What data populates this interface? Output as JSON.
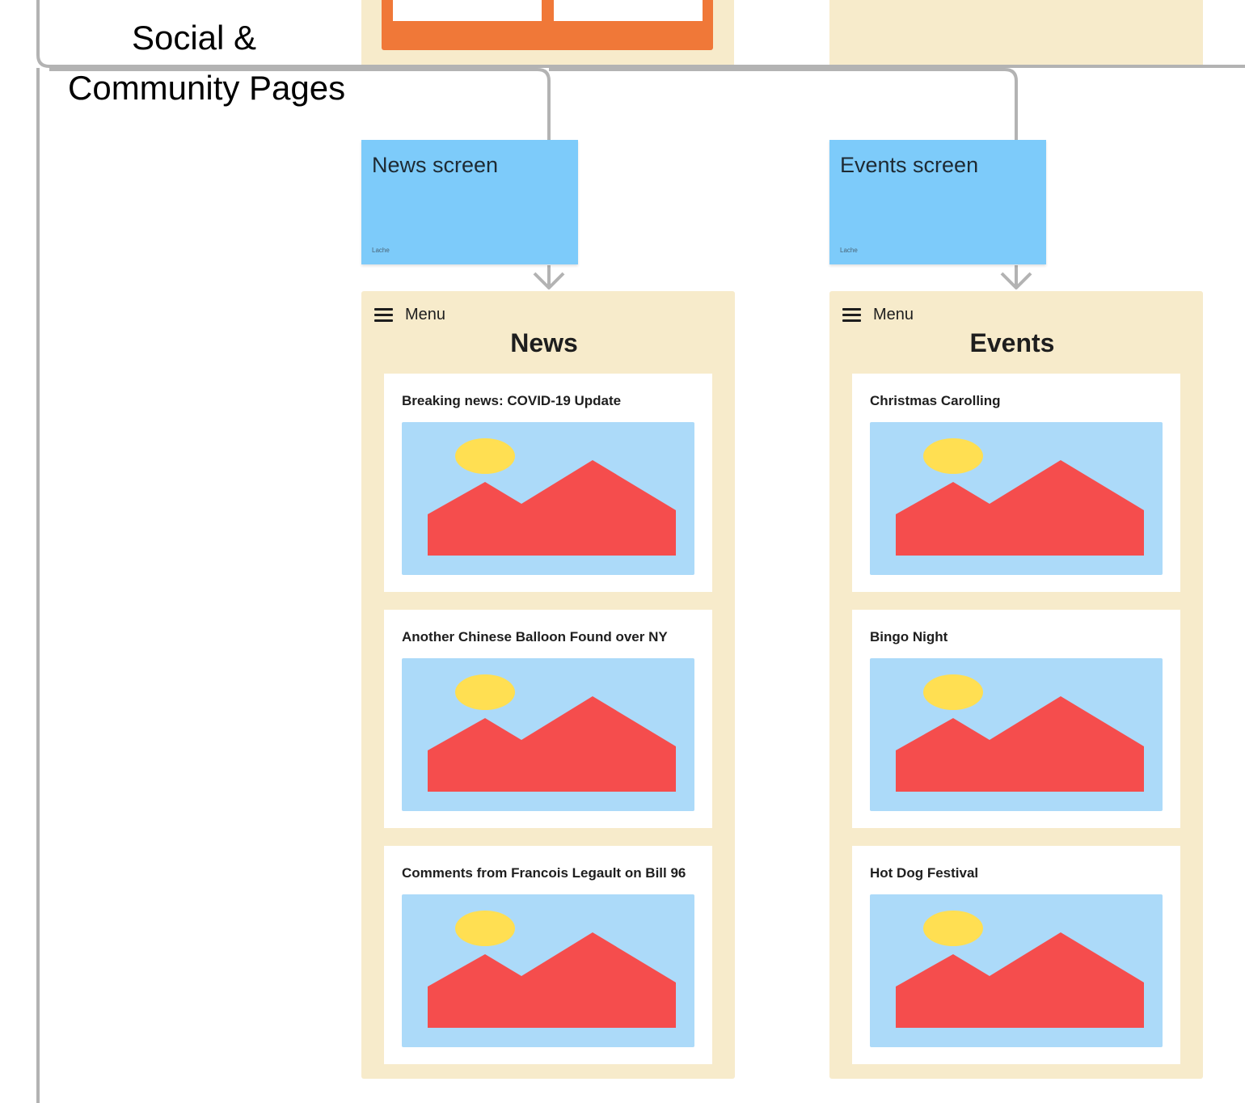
{
  "section": {
    "title_line1": "Social &",
    "title_line2": "Community Pages"
  },
  "stickies": [
    {
      "title": "News screen",
      "author": "Lache"
    },
    {
      "title": "Events screen",
      "author": "Lache"
    }
  ],
  "screens": [
    {
      "menu_label": "Menu",
      "heading": "News",
      "cards": [
        {
          "title": "Breaking news: COVID-19 Update",
          "image_icon": "image-placeholder-icon"
        },
        {
          "title": "Another Chinese Balloon Found over NY",
          "image_icon": "image-placeholder-icon"
        },
        {
          "title": "Comments from Francois Legault on Bill 96",
          "image_icon": "image-placeholder-icon"
        }
      ]
    },
    {
      "menu_label": "Menu",
      "heading": "Events",
      "cards": [
        {
          "title": "Christmas Carolling",
          "image_icon": "image-placeholder-icon"
        },
        {
          "title": "Bingo Night",
          "image_icon": "image-placeholder-icon"
        },
        {
          "title": "Hot Dog Festival",
          "image_icon": "image-placeholder-icon"
        }
      ]
    }
  ],
  "colors": {
    "frame_bg": "#f7ebcb",
    "sticky_bg": "#7dcbfa",
    "accent_orange": "#f07838",
    "image_sky": "#acdaf9",
    "image_sun": "#ffdf52",
    "image_mountain": "#f54d4d",
    "connector": "#b3b3b3"
  }
}
